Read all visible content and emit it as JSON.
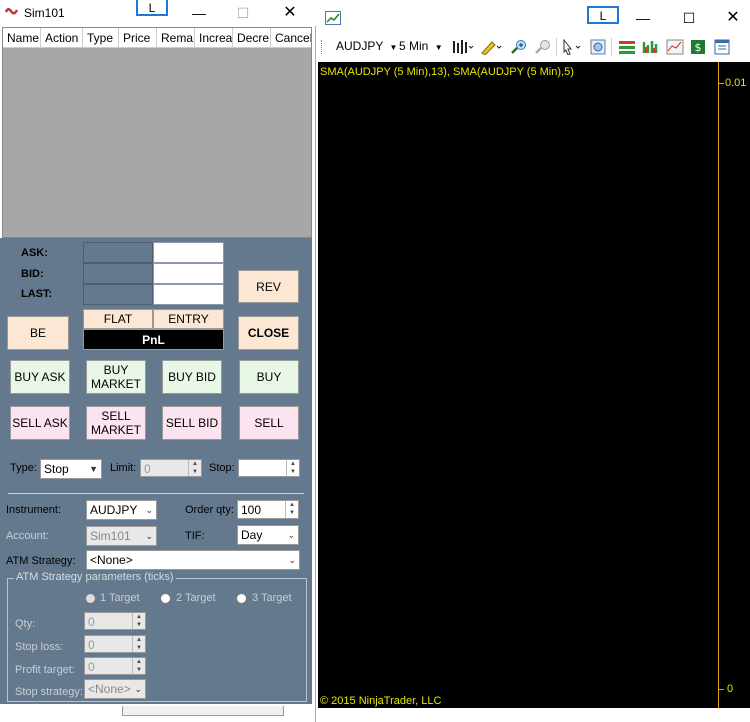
{
  "left_window": {
    "title": "Sim101",
    "layout_button": "L",
    "minimize": "—",
    "maximize": "☐",
    "close": "✕",
    "grid_columns": [
      "Name",
      "Action",
      "Type",
      "Price",
      "Rema",
      "Increa",
      "Decre",
      "Cancel"
    ],
    "quotes": {
      "ask": "ASK:",
      "bid": "BID:",
      "last": "LAST:"
    },
    "buttons": {
      "rev": "REV",
      "be": "BE",
      "close": "CLOSE",
      "flat": "FLAT",
      "entry": "ENTRY",
      "pnl": "PnL",
      "buy_ask": "BUY ASK",
      "buy_market": "BUY MARKET",
      "buy_bid": "BUY BID",
      "buy": "BUY",
      "sell_ask": "SELL ASK",
      "sell_market": "SELL MARKET",
      "sell_bid": "SELL BID",
      "sell": "SELL"
    },
    "order_type": {
      "type_label": "Type:",
      "type_value": "Stop",
      "limit_label": "Limit:",
      "limit_value": "0",
      "stop_label": "Stop:",
      "stop_value": ""
    },
    "instrument_label": "Instrument:",
    "instrument_value": "AUDJPY",
    "order_qty_label": "Order qty:",
    "order_qty_value": "100",
    "account_label": "Account:",
    "account_value": "Sim101",
    "tif_label": "TIF:",
    "tif_value": "Day",
    "atm_label": "ATM Strategy:",
    "atm_value": "<None>",
    "atm_params": {
      "group_label": "ATM Strategy parameters (ticks)",
      "targets": [
        "1 Target",
        "2 Target",
        "3 Target"
      ],
      "qty_label": "Qty:",
      "qty_value": "0",
      "stop_loss_label": "Stop loss:",
      "stop_loss_value": "0",
      "profit_target_label": "Profit target:",
      "profit_target_value": "0",
      "stop_strategy_label": "Stop strategy:",
      "stop_strategy_value": "<None>"
    }
  },
  "right_window": {
    "layout_button": "L",
    "minimize": "—",
    "maximize": "☐",
    "close": "✕",
    "instrument": "AUDJPY",
    "interval": "5 Min",
    "indicator_label": "SMA(AUDJPY (5 Min),13), SMA(AUDJPY (5 Min),5)",
    "axis_top": "0.01",
    "axis_bottom": "0",
    "copyright": "© 2015 NinjaTrader, LLC"
  },
  "colors": {
    "panel": "#65798e",
    "chart_bg": "#000000",
    "chart_text": "#e6e600",
    "buy": "#e9f7e7",
    "sell": "#fbe4ef",
    "neutral": "#fbe7d3"
  }
}
